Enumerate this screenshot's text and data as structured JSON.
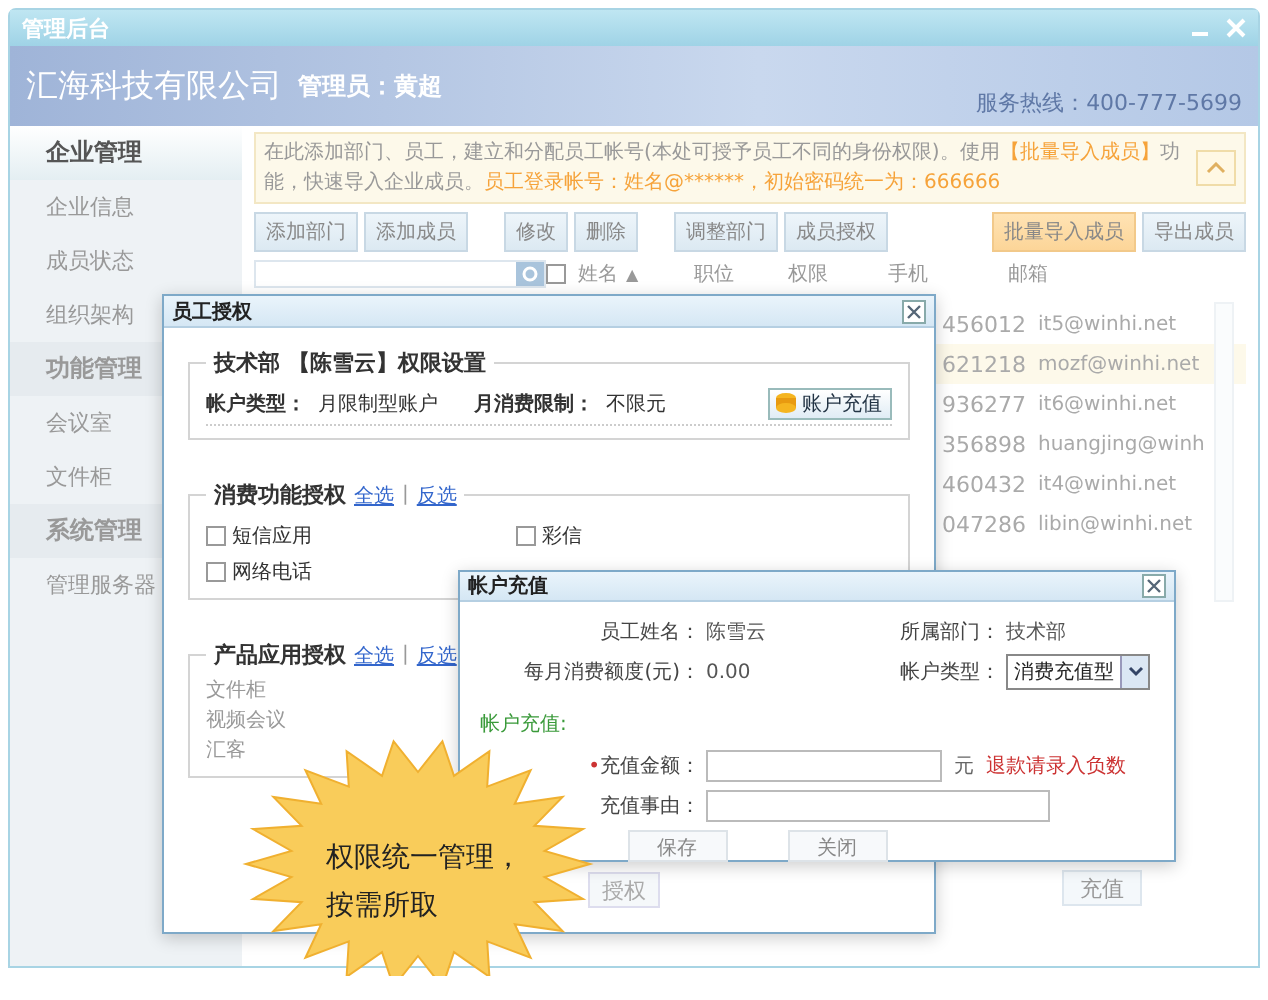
{
  "window": {
    "title": "管理后台"
  },
  "header": {
    "company": "汇海科技有限公司",
    "admin": "管理员：黄超",
    "hotline": "服务热线：400-777-5699"
  },
  "sidebar": {
    "sections": [
      {
        "title": "企业管理",
        "selected": true,
        "items": [
          "企业信息",
          "成员状态",
          "组织架构"
        ]
      },
      {
        "title": "功能管理",
        "selected": false,
        "items": [
          "会议室",
          "文件柜"
        ]
      },
      {
        "title": "系统管理",
        "selected": false,
        "items": [
          "管理服务器"
        ]
      }
    ]
  },
  "notice": {
    "segments": [
      {
        "text": "在此添加部门、员工，建立和分配员工帐号(本处可授予员工不同的身份权限)。使用",
        "highlight": false
      },
      {
        "text": "【批量导入成员】",
        "highlight": true
      },
      {
        "text": "功能，快速导入企业成员。",
        "highlight": false
      },
      {
        "text": "员工登录帐号：姓名@******，初始密码统一为：666666",
        "highlight": true
      }
    ]
  },
  "toolbar": {
    "groups": [
      [
        {
          "label": "添加部门",
          "highlighted": false
        },
        {
          "label": "添加成员",
          "highlighted": false
        }
      ],
      [
        {
          "label": "修改",
          "highlighted": false
        },
        {
          "label": "删除",
          "highlighted": false
        }
      ],
      [
        {
          "label": "调整部门",
          "highlighted": false
        },
        {
          "label": "成员授权",
          "highlighted": false
        }
      ]
    ],
    "right": [
      {
        "label": "批量导入成员",
        "highlighted": true
      },
      {
        "label": "导出成员",
        "highlighted": false
      }
    ]
  },
  "table": {
    "columns": [
      "姓名",
      "职位",
      "权限",
      "手机",
      "邮箱"
    ],
    "sort_mark": "▲",
    "all_checked": false,
    "rows": [
      {
        "phone": "456012",
        "email": "it5@winhi.net",
        "selected": false
      },
      {
        "phone": "621218",
        "email": "mozf@winhi.net",
        "selected": true
      },
      {
        "phone": "936277",
        "email": "it6@winhi.net",
        "selected": false
      },
      {
        "phone": "356898",
        "email": "huangjing@winh",
        "selected": false
      },
      {
        "phone": "460432",
        "email": "it4@winhi.net",
        "selected": false
      },
      {
        "phone": "047286",
        "email": "libin@winhi.net",
        "selected": false
      }
    ]
  },
  "footer_button": "充值",
  "auth_dialog": {
    "title": "员工授权",
    "setting": {
      "legend": "技术部 【陈雪云】权限设置",
      "fields": [
        {
          "label": "帐户类型：",
          "value": "月限制型账户"
        },
        {
          "label": "月消费限制：",
          "value": "不限元"
        }
      ],
      "button": "账户充值"
    },
    "consume": {
      "legend": "消费功能授权",
      "links": [
        "全选",
        "反选"
      ],
      "separator": "|",
      "options": [
        {
          "label": "短信应用",
          "checked": false
        },
        {
          "label": "彩信",
          "checked": false
        },
        {
          "label": "网络电话",
          "checked": false
        }
      ]
    },
    "product": {
      "legend": "产品应用授权",
      "links": [
        "全选",
        "反选"
      ],
      "separator": "|",
      "items": [
        "文件柜",
        "视频会议",
        "汇客"
      ]
    },
    "button": "授权"
  },
  "recharge_dialog": {
    "title": "帐户充值",
    "name": {
      "label": "员工姓名：",
      "value": "陈雪云"
    },
    "dept": {
      "label": "所属部门：",
      "value": "技术部"
    },
    "quota": {
      "label": "每月消费额度(元)：",
      "value": "0.00"
    },
    "type": {
      "label": "帐户类型：",
      "value": "消费充值型"
    },
    "section": "帐户充值:",
    "amount": {
      "required": "•",
      "label": "充值金额：",
      "unit": "元",
      "hint": "退款请录入负数"
    },
    "reason": {
      "label": "充值事由："
    },
    "buttons": [
      "保存",
      "关闭"
    ]
  },
  "badge": {
    "lines": [
      "权限统一管理，",
      "按需所取"
    ]
  }
}
